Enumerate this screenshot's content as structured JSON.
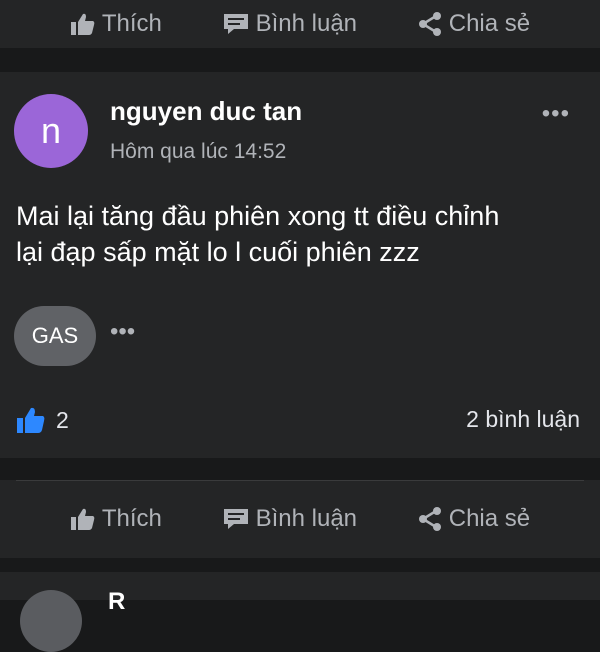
{
  "top_actions": {
    "like": "Thích",
    "comment": "Bình luận",
    "share": "Chia sẻ"
  },
  "post": {
    "avatar_letter": "n",
    "author": "nguyen duc tan",
    "timestamp": "Hôm qua lúc 14:52",
    "more_label": "•••",
    "content_line1": "Mai lại tăng đầu phiên xong tt điều chỉnh",
    "content_line2": "lại đạp sấp mặt lo l cuối phiên zzz",
    "tag": "GAS",
    "tag_more": "•••",
    "like_count": "2",
    "comment_count": "2 bình luận",
    "avatar_color": "#9b66d8"
  },
  "bottom_actions": {
    "like": "Thích",
    "comment": "Bình luận",
    "share": "Chia sẻ"
  },
  "next_post": {
    "author_partial": "R"
  }
}
